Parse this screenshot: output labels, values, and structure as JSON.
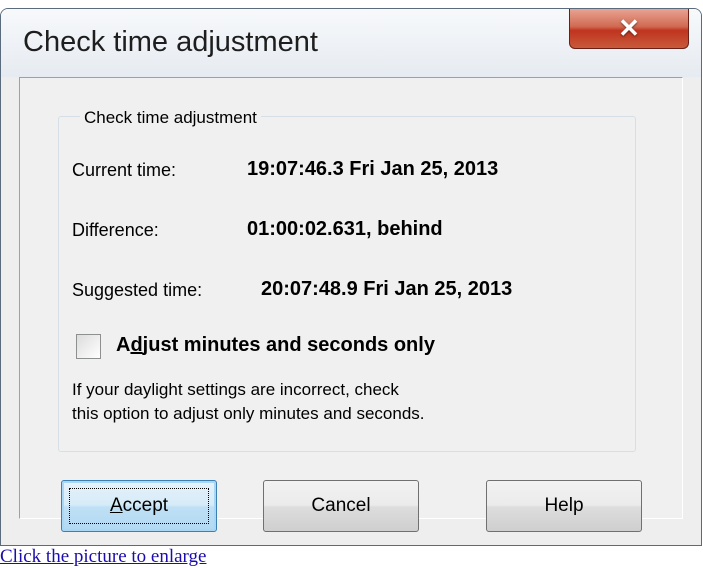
{
  "window": {
    "title": "Check time adjustment",
    "close_glyph": "✕"
  },
  "group": {
    "legend": "Check time adjustment",
    "rows": [
      {
        "label": "Current time:",
        "value": "19:07:46.3 Fri Jan 25, 2013"
      },
      {
        "label": "Difference:",
        "value": "01:00:02.631, behind"
      },
      {
        "label": "Suggested time:",
        "value": "20:07:48.9 Fri Jan 25, 2013"
      }
    ],
    "checkbox": {
      "label_before": "A",
      "label_mnemonic": "d",
      "label_after": "just minutes and seconds only",
      "checked": false
    },
    "hint_line1": "If your daylight settings are incorrect, check",
    "hint_line2": "this option to adjust only minutes and seconds."
  },
  "buttons": {
    "accept_mnemonic": "A",
    "accept_rest": "ccept",
    "cancel": "Cancel",
    "help": "Help"
  },
  "caption": "Click the picture to enlarge"
}
